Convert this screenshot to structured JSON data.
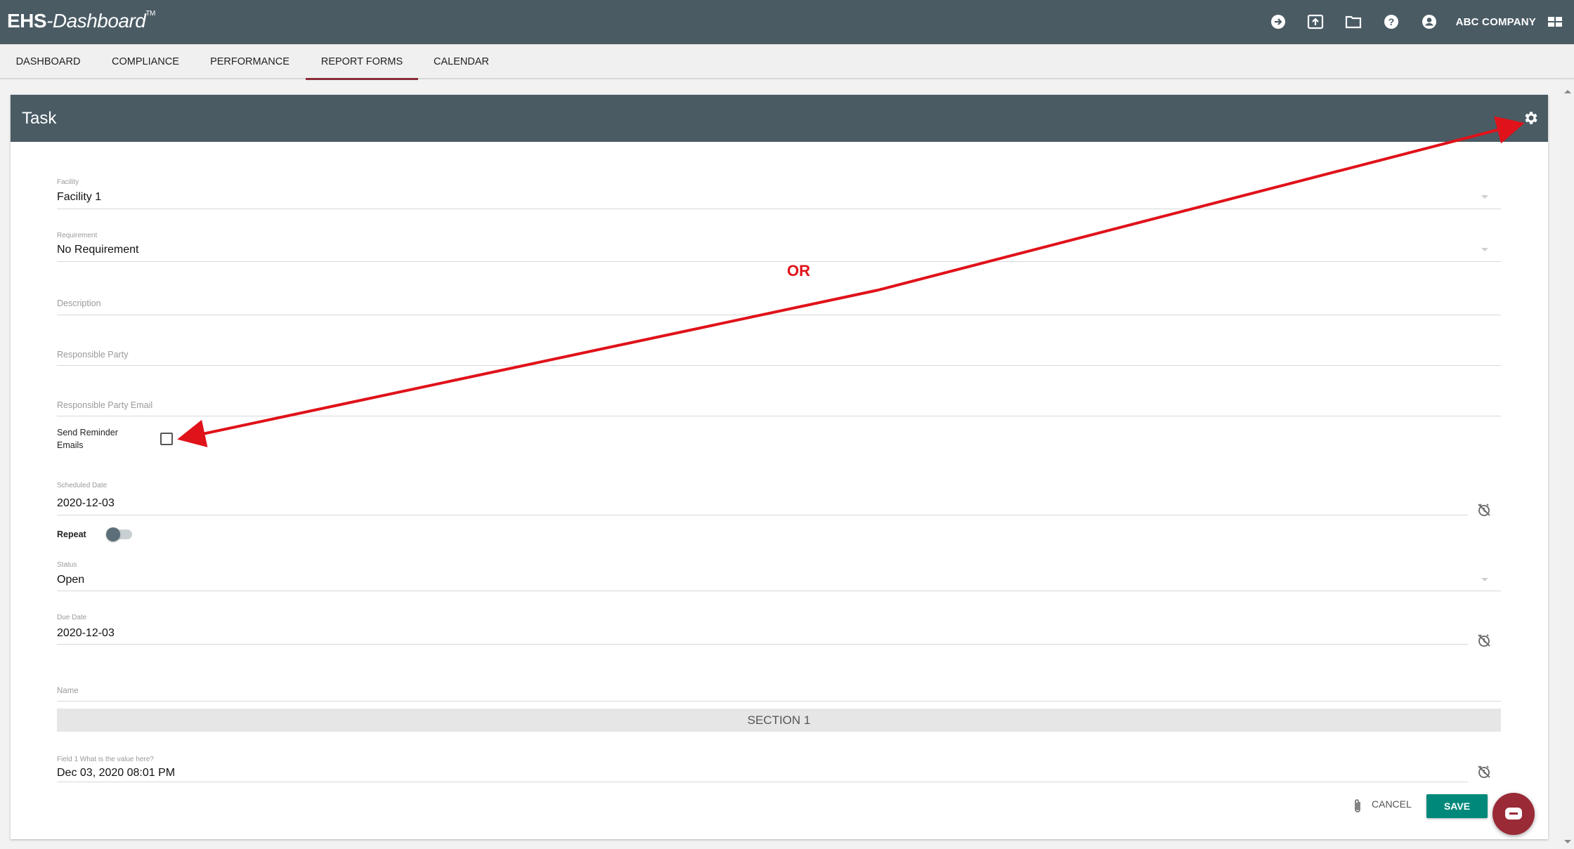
{
  "app": {
    "logo_brand": "EHS",
    "logo_rest": "-Dashboard",
    "logo_tm": "TM",
    "company": "ABC COMPANY",
    "top_icons": [
      "arrow-circle-icon",
      "upload-box-icon",
      "folder-icon",
      "help-icon",
      "account-icon",
      "apps-grid-icon"
    ]
  },
  "nav": {
    "tabs": [
      {
        "label": "DASHBOARD",
        "active": false
      },
      {
        "label": "COMPLIANCE",
        "active": false
      },
      {
        "label": "PERFORMANCE",
        "active": false
      },
      {
        "label": "REPORT FORMS",
        "active": true
      },
      {
        "label": "CALENDAR",
        "active": false
      }
    ]
  },
  "card": {
    "title": "Task"
  },
  "form": {
    "facility": {
      "label": "Facility",
      "value": "Facility 1"
    },
    "requirement": {
      "label": "Requirement",
      "value": "No Requirement"
    },
    "description": {
      "placeholder": "Description"
    },
    "responsible_party": {
      "placeholder": "Responsible Party"
    },
    "responsible_party_email": {
      "placeholder": "Responsible Party Email"
    },
    "send_reminder": {
      "label_line1": "Send Reminder",
      "label_line2": "Emails",
      "checked": false
    },
    "scheduled_date": {
      "label": "Scheduled Date",
      "value": "2020-12-03"
    },
    "repeat": {
      "label": "Repeat",
      "on": false
    },
    "status": {
      "label": "Status",
      "value": "Open"
    },
    "due_date": {
      "label": "Due Date",
      "value": "2020-12-03"
    },
    "name": {
      "placeholder": "Name"
    },
    "section": {
      "title": "SECTION 1"
    },
    "field1": {
      "label": "Field 1 What is the value here?",
      "value": "Dec 03, 2020 08:01 PM"
    }
  },
  "actions": {
    "cancel": "CANCEL",
    "save": "SAVE"
  },
  "annotation": {
    "text": "OR",
    "color": "#e0121a"
  },
  "colors": {
    "header": "#4a5b64",
    "accent_tab": "#8b2c3a",
    "save": "#00897b",
    "chat": "#9a2a36"
  }
}
